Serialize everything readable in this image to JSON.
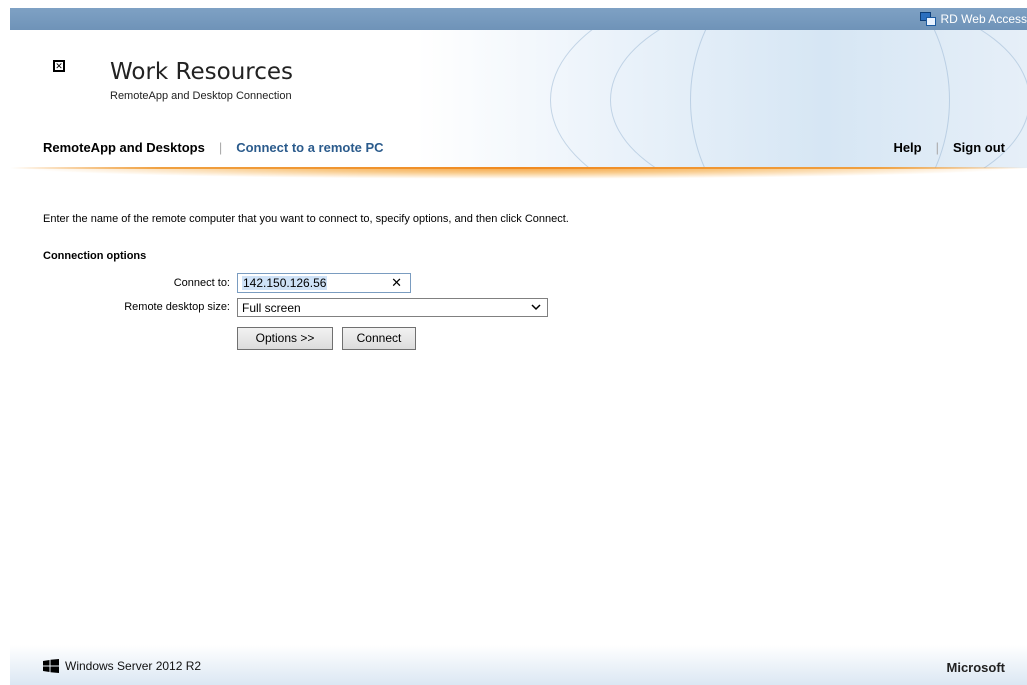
{
  "top_bar": {
    "rd_label": "RD Web Access"
  },
  "header": {
    "title": "Work Resources",
    "subtitle": "RemoteApp and Desktop Connection"
  },
  "nav": {
    "remoteapp_label": "RemoteApp and Desktops",
    "connect_remote_label": "Connect to a remote PC",
    "help_label": "Help",
    "signout_label": "Sign out"
  },
  "content": {
    "instructions": "Enter the name of the remote computer that you want to connect to, specify options, and then click Connect.",
    "section_title": "Connection options",
    "connect_to": {
      "label": "Connect to:",
      "value": "142.150.126.56"
    },
    "desktop_size": {
      "label": "Remote desktop size:",
      "value": "Full screen"
    },
    "options_button": "Options >>",
    "connect_button": "Connect"
  },
  "footer": {
    "left_text": "Windows Server 2012 R2",
    "right_text": "Microsoft"
  },
  "colors": {
    "accent_orange": "#f08a20",
    "nav_link": "#2b5b8c",
    "top_bar": "#7ea1c4"
  }
}
